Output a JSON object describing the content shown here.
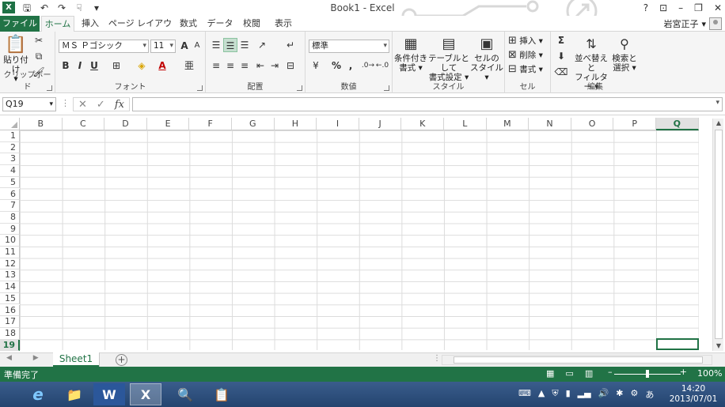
{
  "window": {
    "title": "Book1 - Excel",
    "app_icon": "X",
    "help": "?",
    "controls": [
      "⊡",
      "–",
      "❐",
      "✕"
    ]
  },
  "qat": {
    "save": "🖫",
    "undo": "↶",
    "redo": "↷",
    "touch": "☟",
    "more": "▾"
  },
  "tabs": {
    "file": "ファイル",
    "items": [
      "ホーム",
      "挿入",
      "ページ レイアウト",
      "数式",
      "データ",
      "校閲",
      "表示"
    ],
    "active": 0
  },
  "user": {
    "name": "岩宮正子",
    "dropdown": "▾"
  },
  "ribbon": {
    "clipboard": {
      "label": "クリップボード",
      "paste": "貼り付け",
      "paste_arrow": "▾"
    },
    "font": {
      "label": "フォント",
      "family": "ＭＳ Ｐゴシック",
      "size": "11",
      "grow": "A",
      "shrink": "A",
      "bold": "B",
      "italic": "I",
      "underline": "U"
    },
    "alignment": {
      "label": "配置"
    },
    "number": {
      "label": "数値",
      "format": "標準",
      "percent": "%",
      "comma": ","
    },
    "styles": {
      "label": "スタイル",
      "conditional_1": "条件付き",
      "conditional_2": "書式 ▾",
      "table_1": "テーブルとして",
      "table_2": "書式設定 ▾",
      "cell_1": "セルの",
      "cell_2": "スタイル ▾"
    },
    "cells": {
      "label": "セル",
      "insert": "挿入",
      "delete": "削除",
      "format": "書式"
    },
    "editing": {
      "label": "編集",
      "sort_1": "並べ替えと",
      "sort_2": "フィルター ▾",
      "find_1": "検索と",
      "find_2": "選択 ▾",
      "sigma": "Σ"
    }
  },
  "formula_bar": {
    "name_box": "Q19",
    "cancel": "✕",
    "enter": "✓",
    "fx": "fx",
    "dots": "⋮",
    "value": ""
  },
  "grid": {
    "columns": [
      "B",
      "C",
      "D",
      "E",
      "F",
      "G",
      "H",
      "I",
      "J",
      "K",
      "L",
      "M",
      "N",
      "O",
      "P",
      "Q"
    ],
    "rows": [
      "1",
      "2",
      "3",
      "4",
      "5",
      "6",
      "7",
      "8",
      "9",
      "10",
      "11",
      "12",
      "13",
      "14",
      "15",
      "16",
      "17",
      "18",
      "19"
    ],
    "selected_column": "Q",
    "selected_row": "19"
  },
  "sheets": {
    "tabs": [
      "Sheet1"
    ],
    "add": "+",
    "nav": "◀ ▶"
  },
  "status": {
    "text": "準備完了",
    "zoom": "100%",
    "zoom_minus": "–",
    "zoom_plus": "+"
  },
  "taskbar": {
    "items": [
      "e",
      "📁",
      "W",
      "X",
      "🔍",
      "📋"
    ],
    "active_index": 3,
    "time": "14:20",
    "date": "2013/07/01",
    "ime": "あ"
  }
}
